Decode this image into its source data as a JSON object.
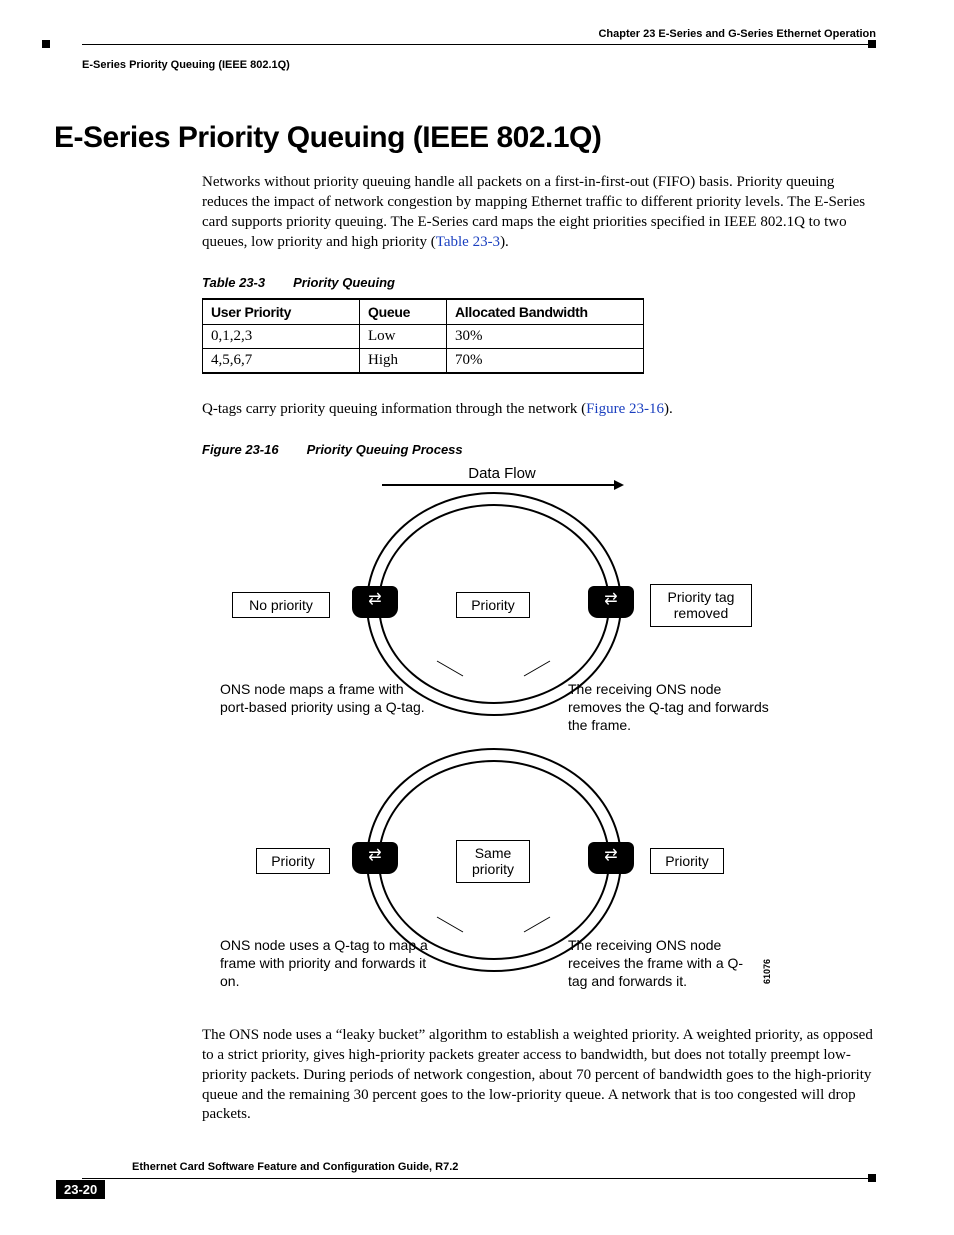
{
  "header": {
    "chapter": "Chapter 23 E-Series and G-Series Ethernet Operation",
    "section": "E-Series Priority Queuing (IEEE 802.1Q)"
  },
  "heading": "E-Series Priority Queuing (IEEE 802.1Q)",
  "para1_a": "Networks without priority queuing handle all packets on a first-in-first-out (FIFO) basis. Priority queuing reduces the impact of network congestion by mapping Ethernet traffic to different priority levels. The E-Series card supports priority queuing. The E-Series card maps the eight priorities specified in IEEE 802.1Q to two queues, low priority and high priority (",
  "para1_link": "Table 23-3",
  "para1_b": ").",
  "table": {
    "number": "Table 23-3",
    "title": "Priority Queuing",
    "headers": [
      "User Priority",
      "Queue",
      "Allocated Bandwidth"
    ],
    "rows": [
      [
        "0,1,2,3",
        "Low",
        "30%"
      ],
      [
        "4,5,6,7",
        "High",
        "70%"
      ]
    ]
  },
  "para2_a": "Q-tags carry priority queuing information through the network (",
  "para2_link": "Figure 23-16",
  "para2_b": ").",
  "figure": {
    "number": "Figure 23-16",
    "title": "Priority Queuing Process",
    "flow_label": "Data Flow",
    "ring1": {
      "left_tag": "No priority",
      "mid_tag": "Priority",
      "right_tag": "Priority tag removed",
      "left_caption": "ONS node maps a frame with port-based priority using a Q-tag.",
      "right_caption": "The receiving ONS node removes the Q-tag and forwards the frame."
    },
    "ring2": {
      "left_tag": "Priority",
      "mid_tag": "Same priority",
      "right_tag": "Priority",
      "left_caption": "ONS node uses a Q-tag to map a frame with priority and forwards it on.",
      "right_caption": "The receiving ONS node receives the frame with a Q-tag and forwards it."
    },
    "id": "61076"
  },
  "para3": "The ONS node uses a “leaky bucket” algorithm to establish a weighted priority. A weighted priority, as opposed to a strict priority, gives high-priority packets greater access to bandwidth, but does not totally preempt low-priority packets. During periods of network congestion, about 70 percent of bandwidth goes to the high-priority queue and the remaining 30 percent goes to the low-priority queue. A network that is too congested will drop packets.",
  "footer": {
    "doc_title": "Ethernet Card Software Feature and Configuration Guide, R7.2",
    "page_num": "23-20"
  }
}
